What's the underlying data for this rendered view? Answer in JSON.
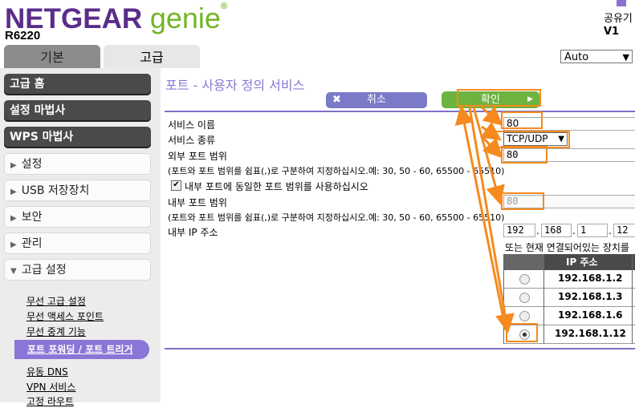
{
  "header": {
    "brand_main": "NETGEAR",
    "brand_genie": "genie",
    "brand_reg": "®",
    "model": "R6220",
    "right_line1": "공유기",
    "right_line2": "V1"
  },
  "tabs": [
    {
      "label": "기본",
      "active": false
    },
    {
      "label": "고급",
      "active": true
    }
  ],
  "language_select": {
    "value": "Auto"
  },
  "sidebar": {
    "primary": [
      {
        "label": "고급 홈"
      },
      {
        "label": "설정 마법사"
      },
      {
        "label": "WPS 마법사"
      }
    ],
    "sections": [
      {
        "label": "설정"
      },
      {
        "label": "USB 저장장치"
      },
      {
        "label": "보안"
      },
      {
        "label": "관리"
      },
      {
        "label": "고급 설정"
      }
    ],
    "sublinks": [
      {
        "label": "무선 고급 설정"
      },
      {
        "label": "무선 액세스 포인트"
      },
      {
        "label": "무선 중계 기능"
      },
      {
        "label": "포트 포워딩 / 포트 트리거",
        "active": true
      },
      {
        "label": "유동 DNS"
      },
      {
        "label": "VPN 서비스"
      },
      {
        "label": "고정 라우트"
      }
    ]
  },
  "main": {
    "title": "포트 - 사용자 정의 서비스",
    "cancel_label": "취소",
    "apply_label": "확인",
    "service_name_label": "서비스 이름",
    "service_name_value": "80",
    "service_type_label": "서비스 종류",
    "service_type_value": "TCP/UDP",
    "external_port_label": "외부 포트 범위",
    "external_port_value": "80",
    "port_hint": "(포트와 포트 범위를 쉼표(,)로 구분하여 지정하십시오.예: 30, 50 - 60, 65500 - 65510)",
    "same_range_label": "내부 포트에 동일한 포트 범위를 사용하십시오",
    "same_range_checked": true,
    "internal_port_label": "내부 포트 범위",
    "internal_port_value": "80",
    "port_hint2": "(포트와 포트 범위를 쉼표(,)로 구분하여 지정하십시오.예: 30, 50 - 60, 65500 - 65510)",
    "internal_ip_label": "내부 IP 주소",
    "ip_octets": [
      "192",
      "168",
      "1",
      "12"
    ],
    "device_hint": "또는 현재 연결되어있는 장치를",
    "ip_table": {
      "header": "IP 주소",
      "rows": [
        {
          "ip": "192.168.1.2",
          "selected": false
        },
        {
          "ip": "192.168.1.3",
          "selected": false
        },
        {
          "ip": "192.168.1.6",
          "selected": false
        },
        {
          "ip": "192.168.1.12",
          "selected": true
        }
      ]
    }
  },
  "colors": {
    "brand_purple": "#5a2d8a",
    "genie_green": "#72b526",
    "accent_purple": "#8a78d4",
    "apply_green": "#6cb33f",
    "annotation_orange": "#f68a1e"
  }
}
